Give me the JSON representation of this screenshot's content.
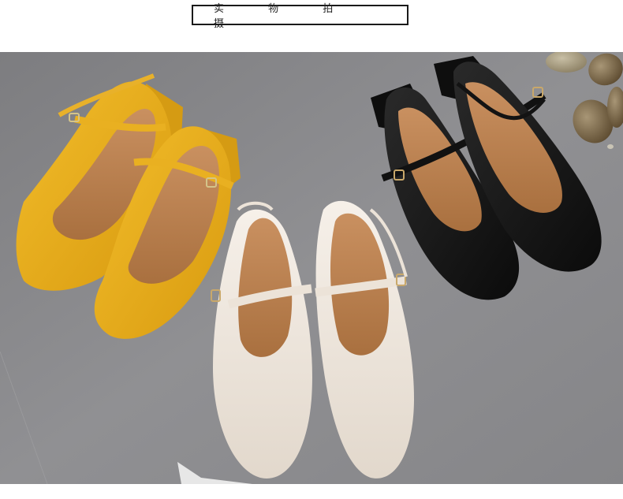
{
  "header": {
    "title": "实 物 拍 摄"
  },
  "photo": {
    "subject": "product-photo",
    "colors": {
      "background": "#8a8a8c",
      "yellow_shoe": "#e7ac1a",
      "cream_shoe": "#ede5dc",
      "black_shoe": "#151515",
      "insole": "#c48a58",
      "pebble": "#8a7352"
    }
  }
}
